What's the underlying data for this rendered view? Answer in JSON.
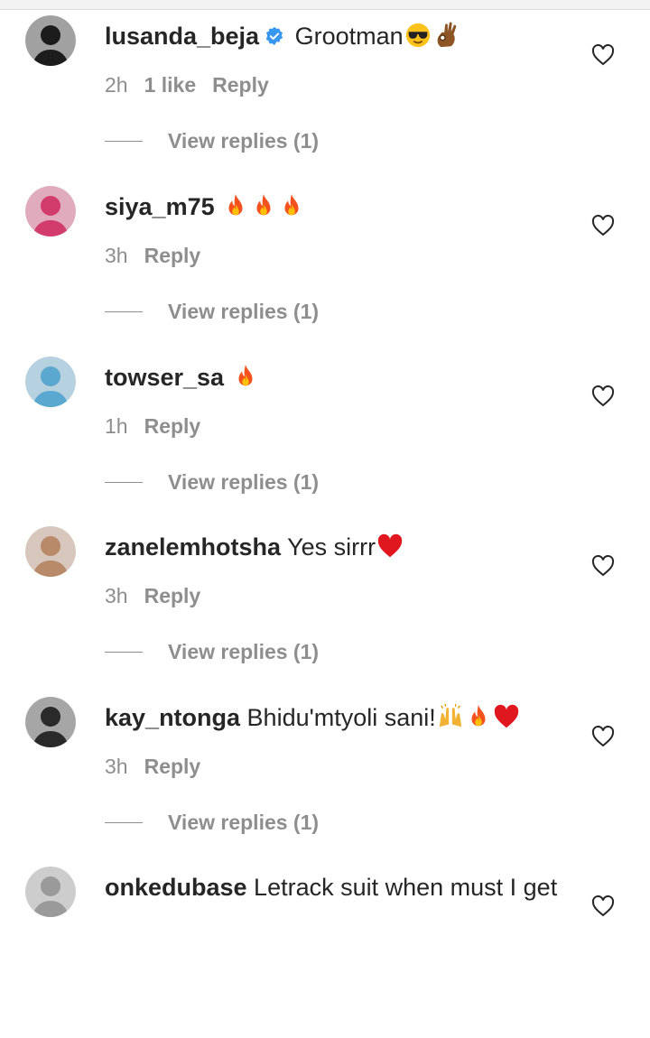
{
  "comments": [
    {
      "username": "lusanda_beja",
      "verified": true,
      "text": "Grootman",
      "emojis": [
        "sunglasses-face",
        "ok-hand"
      ],
      "time": "2h",
      "likes": "1 like",
      "reply_label": "Reply",
      "view_replies": "View replies (1)",
      "avatar_color": "#1c1c1c"
    },
    {
      "username": "siya_m75",
      "verified": false,
      "text": "",
      "emojis": [
        "fire",
        "fire",
        "fire"
      ],
      "time": "3h",
      "likes": "",
      "reply_label": "Reply",
      "view_replies": "View replies (1)",
      "avatar_color": "#d23c6c"
    },
    {
      "username": "towser_sa",
      "verified": false,
      "text": "",
      "emojis": [
        "fire"
      ],
      "time": "1h",
      "likes": "",
      "reply_label": "Reply",
      "view_replies": "View replies (1)",
      "avatar_color": "#5aa7cf"
    },
    {
      "username": "zanelemhotsha",
      "verified": false,
      "text": "Yes sirrr",
      "emojis": [
        "red-heart"
      ],
      "time": "3h",
      "likes": "",
      "reply_label": "Reply",
      "view_replies": "View replies (1)",
      "avatar_color": "#b98a6a"
    },
    {
      "username": "kay_ntonga",
      "verified": false,
      "text": "Bhidu'mtyoli sani!",
      "emojis": [
        "raising-hands",
        "fire",
        "red-heart"
      ],
      "time": "3h",
      "likes": "",
      "reply_label": "Reply",
      "view_replies": "View replies (1)",
      "avatar_color": "#2a2a2a"
    },
    {
      "username": "onkedubase",
      "verified": false,
      "text": "Letrack suit when must I get",
      "emojis": [],
      "time": "",
      "likes": "",
      "reply_label": "",
      "view_replies": "",
      "avatar_color": "#9a9a9a"
    }
  ],
  "colors": {
    "text": "#262626",
    "muted": "#8e8e8e",
    "verified": "#3897f0"
  }
}
